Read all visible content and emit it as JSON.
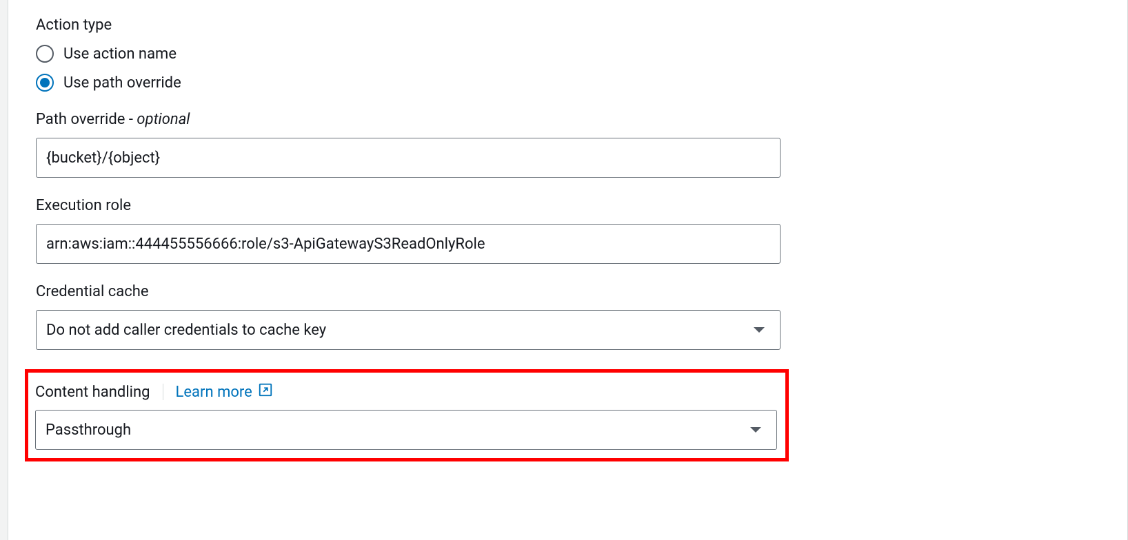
{
  "form": {
    "action_type": {
      "label": "Action type",
      "options": {
        "use_action_name": "Use action name",
        "use_path_override": "Use path override"
      },
      "selected": "use_path_override"
    },
    "path_override": {
      "label": "Path override - ",
      "optional_text": "optional",
      "value": "{bucket}/{object}"
    },
    "execution_role": {
      "label": "Execution role",
      "value": "arn:aws:iam::444455556666:role/s3-ApiGatewayS3ReadOnlyRole"
    },
    "credential_cache": {
      "label": "Credential cache",
      "selected": "Do not add caller credentials to cache key"
    },
    "content_handling": {
      "label": "Content handling",
      "learn_more": "Learn more",
      "selected": "Passthrough"
    }
  }
}
